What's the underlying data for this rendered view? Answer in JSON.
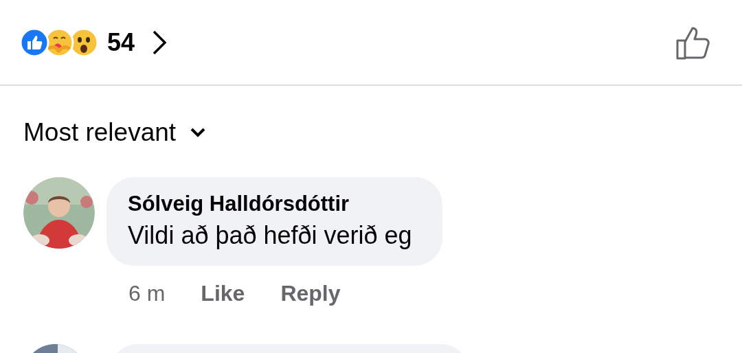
{
  "reactions": {
    "icons": [
      {
        "kind": "like"
      },
      {
        "kind": "care"
      },
      {
        "kind": "wow"
      }
    ],
    "count": "54"
  },
  "sort": {
    "label": "Most relevant"
  },
  "comments": [
    {
      "author": "Sólveig Halldórsdóttir",
      "text": "Vildi að það hefði verið eg",
      "time": "6 m",
      "actions": [
        "Like",
        "Reply"
      ]
    }
  ],
  "more_comments": true
}
